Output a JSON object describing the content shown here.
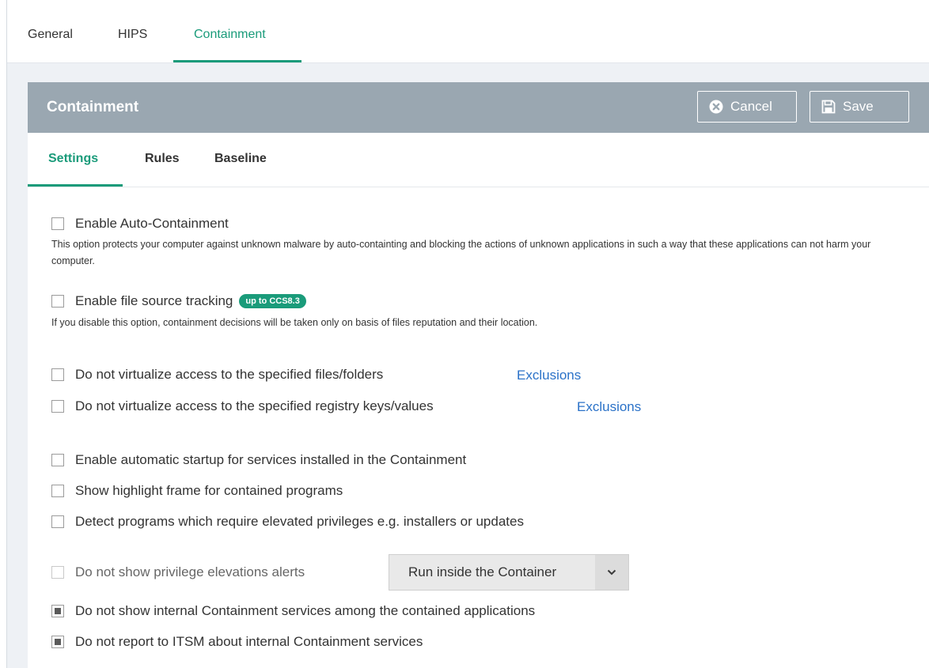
{
  "top_tabs": [
    {
      "label": "General",
      "active": false
    },
    {
      "label": "HIPS",
      "active": false
    },
    {
      "label": "Containment",
      "active": true
    }
  ],
  "panel": {
    "title": "Containment",
    "cancel_label": "Cancel",
    "save_label": "Save",
    "header_color": "#9aa7b1"
  },
  "sub_tabs": [
    {
      "label": "Settings",
      "active": true
    },
    {
      "label": "Rules",
      "active": false
    },
    {
      "label": "Baseline",
      "active": false
    }
  ],
  "accent_color": "#1a9b7a",
  "options": {
    "auto_containment": {
      "label": "Enable Auto-Containment",
      "checked": false,
      "description": "This option protects your computer against unknown malware by auto-containting and blocking the actions of unknown applications in such a way that these applications can not harm your computer."
    },
    "file_source_tracking": {
      "label": "Enable file source tracking",
      "badge": "up to CCS8.3",
      "checked": false,
      "description": "If you disable this option, containment decisions will be taken only on basis of files reputation and their location."
    },
    "no_virtualize_files": {
      "label": "Do not virtualize access to the specified files/folders",
      "link": "Exclusions",
      "checked": false
    },
    "no_virtualize_registry": {
      "label": "Do not virtualize access to the specified registry keys/values",
      "link": "Exclusions",
      "checked": false
    },
    "auto_startup_services": {
      "label": "Enable automatic startup for services installed in the Containment",
      "checked": false
    },
    "highlight_frame": {
      "label": "Show highlight frame for contained programs",
      "checked": false
    },
    "detect_elevated": {
      "label": "Detect programs which require elevated privileges e.g. installers or updates",
      "checked": false
    },
    "no_privilege_alerts": {
      "label": "Do not show privilege elevations alerts",
      "checked": false,
      "disabled": true,
      "select_value": "Run inside the Container"
    },
    "hide_internal_services": {
      "label": "Do not show internal Containment services among the contained applications",
      "checked": true
    },
    "no_report_itsm": {
      "label": "Do not report to ITSM about internal Containment services",
      "checked": true
    }
  }
}
